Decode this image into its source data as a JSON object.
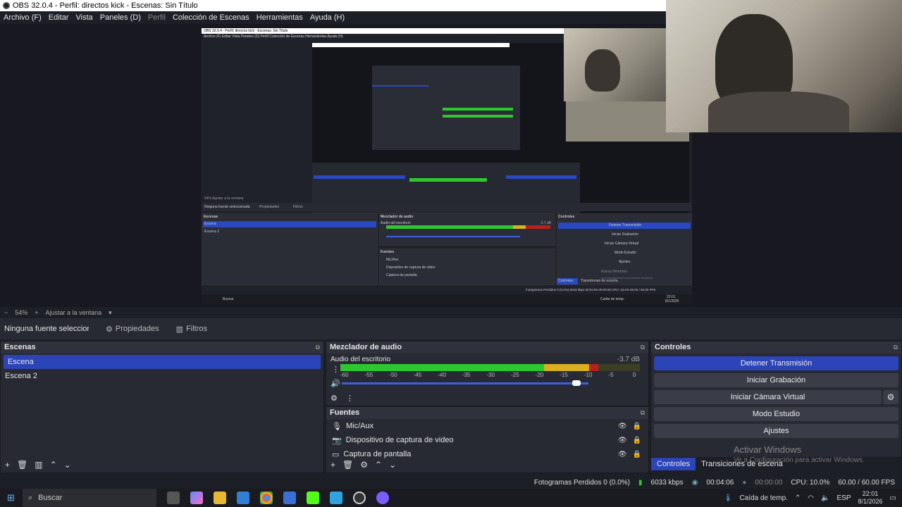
{
  "window": {
    "title": "OBS 32.0.4 - Perfil: directos kick - Escenas: Sin Título"
  },
  "menu": [
    {
      "label": "Archivo (F)",
      "dim": false
    },
    {
      "label": "Editar",
      "dim": false
    },
    {
      "label": "Vista",
      "dim": false
    },
    {
      "label": "Paneles (D)",
      "dim": false
    },
    {
      "label": "Perfil",
      "dim": true
    },
    {
      "label": "Colección de Escenas",
      "dim": false
    },
    {
      "label": "Herramientas",
      "dim": false
    },
    {
      "label": "Ayuda (H)",
      "dim": false
    }
  ],
  "zoom": {
    "percent": "54%",
    "fit_label": "Ajustar a la ventana"
  },
  "source_toolbar": {
    "no_source": "Ninguna fuente seleccionada",
    "properties": "Propiedades",
    "filters": "Filtros"
  },
  "scenes": {
    "title": "Escenas",
    "items": [
      "Escena",
      "Escena 2"
    ],
    "selected": 0
  },
  "mixer": {
    "title": "Mezclador de audio",
    "channel": "Audio del escritorio",
    "db": "-3.7 dB",
    "ticks": [
      "-60",
      "-55",
      "-50",
      "-45",
      "-40",
      "-35",
      "-30",
      "-25",
      "-20",
      "-15",
      "-10",
      "-5",
      "0"
    ],
    "level": 0.86,
    "volume": 0.95
  },
  "sources": {
    "title": "Fuentes",
    "items": [
      {
        "label": "Mic/Aux",
        "icon": "mic-icon"
      },
      {
        "label": "Dispositivo de captura de video",
        "icon": "camera-icon"
      },
      {
        "label": "Captura de pantalla",
        "icon": "monitor-icon"
      }
    ]
  },
  "controls": {
    "title": "Controles",
    "buttons": [
      "Detener Transmisión",
      "Iniciar Grabación",
      "Iniciar Cámara Virtual",
      "Modo Estudio",
      "Ajustes"
    ]
  },
  "dock_tabs": [
    "Controles",
    "Transiciones de escena"
  ],
  "watermark": {
    "line1": "Activar Windows",
    "line2": "Ve a Configuración para activar Windows."
  },
  "status": {
    "dropped": "Fotogramas Perdidos 0 (0.0%)",
    "kbps": "6033 kbps",
    "stream_time": "00:04:06",
    "rec_time": "00:00:00",
    "cpu": "CPU: 10.0%",
    "fps": "60.00 / 60.00 FPS"
  },
  "taskbar": {
    "search_placeholder": "Buscar",
    "weather": "Caída de temp.",
    "lang": "ESP",
    "time": "22:01",
    "date": "8/1/2026"
  },
  "nested": {
    "title": "OBS 32.0.4 - Perfil: directos kick - Escenas: Sin Título",
    "menu": "Archivo (F)   Editar   Vista   Paneles (D)   Perfil   Colección de Escenas   Herramientas   Ayuda (H)",
    "zoom": "54%   Ajustar a la ventana",
    "no_source": "Ninguna fuente seleccionada",
    "props": "Propiedades",
    "filters": "Filtros",
    "scenes": "Escenas",
    "scene1": "Escena",
    "scene2": "Escena 2",
    "mixer": "Mezclador de audio",
    "audio": "Audio del escritorio",
    "db": "-3.7 dB",
    "sources": "Fuentes",
    "mic": "Mic/Aux",
    "cam": "Dispositivo de captura de video",
    "screen": "Captura de pantalla",
    "controls": "Controles",
    "b1": "Detener Transmisión",
    "b2": "Iniciar Grabación",
    "b3": "Iniciar Cámara Virtual",
    "b4": "Modo Estudio",
    "b5": "Ajustes",
    "tab1": "Controles",
    "tab2": "Transiciones de escena",
    "wm": "Activar Windows",
    "wm2": "Ve a Configuración para activar Windows.",
    "status": "Fotogramas Perdidos 0 (0.0%)   6033 kbps   00:04:06   00:00:00   CPU: 10.0%   60.00 / 60.00 FPS",
    "search": "Buscar",
    "weather": "Caída de temp.",
    "time": "22:01",
    "date": "8/1/2026"
  },
  "colors": {
    "accent": "#2b44b8",
    "bg": "#1d1f26",
    "panel": "#272a33",
    "meter_green": "#2ec82e",
    "meter_yellow": "#d8b020",
    "meter_red": "#b82020"
  }
}
